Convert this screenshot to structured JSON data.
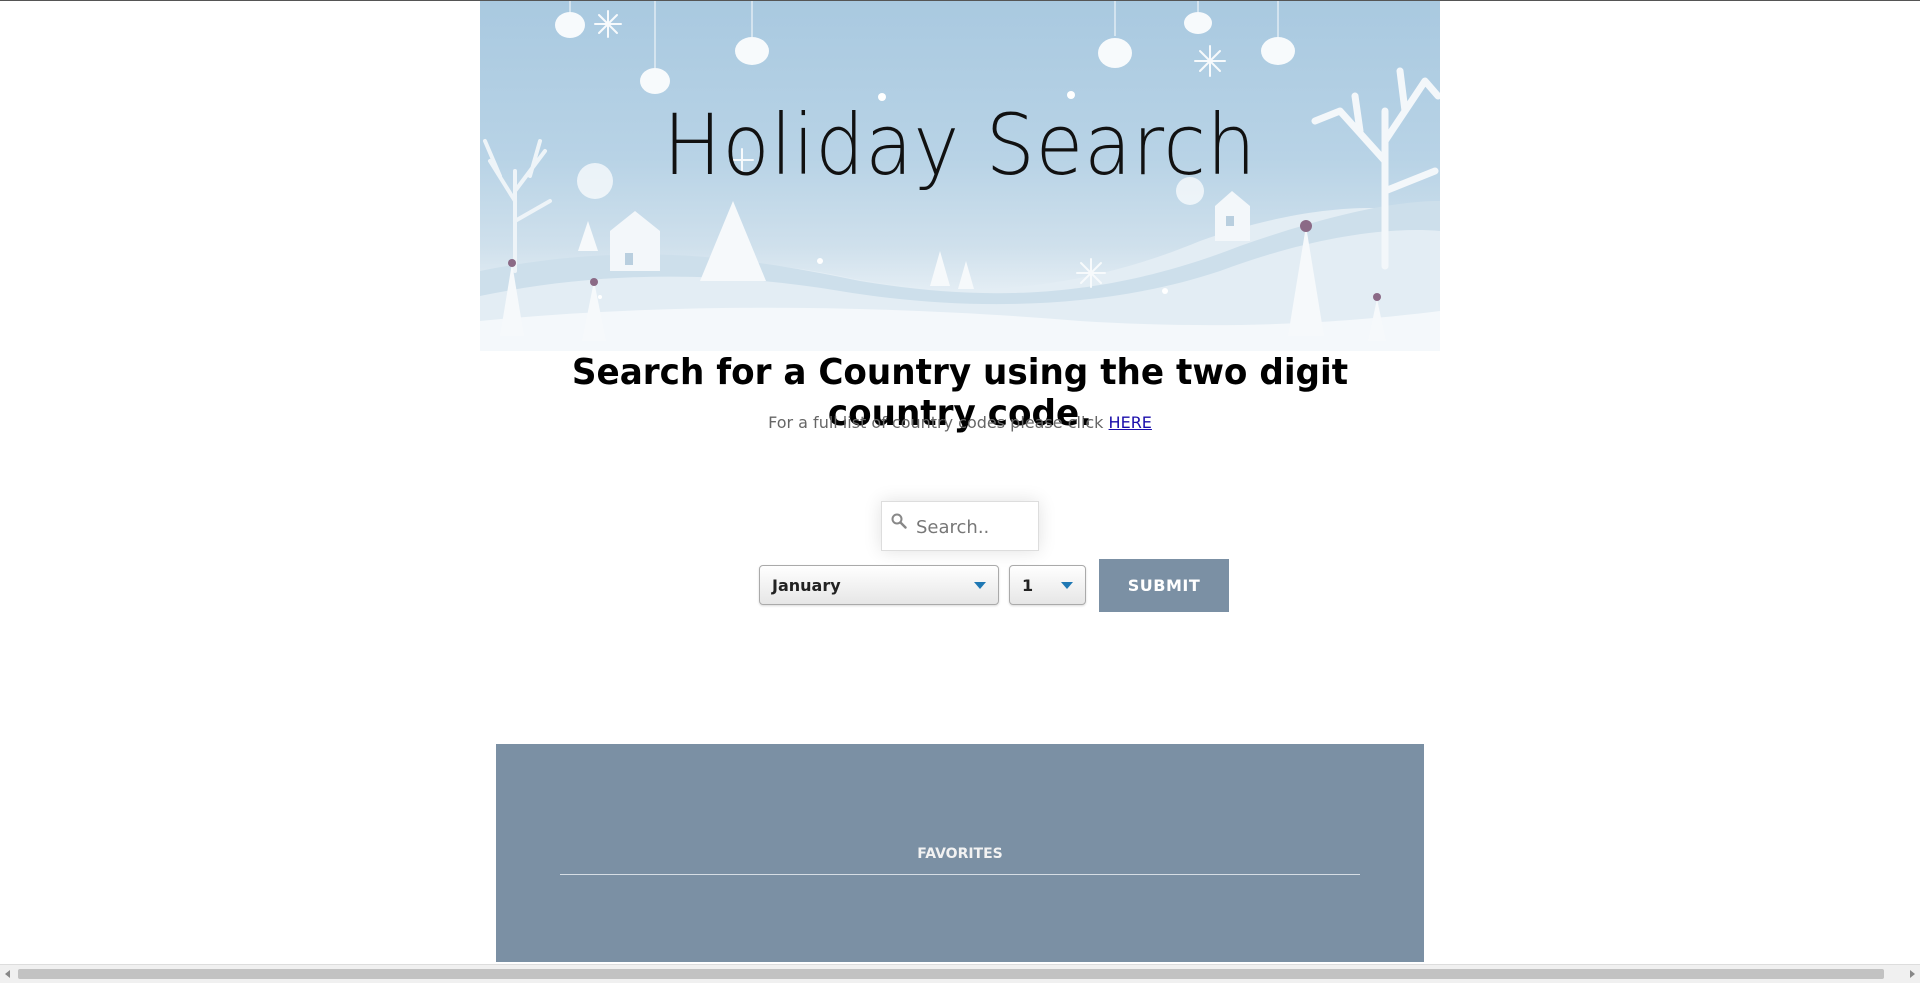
{
  "banner": {
    "title": "Holiday Search"
  },
  "main": {
    "headline": "Search for a Country using the two digit country code.",
    "subtext": "For a full list of country codes please click",
    "link_label": "HERE"
  },
  "search": {
    "placeholder": "Search..",
    "icon": "search-icon"
  },
  "form": {
    "month_selected": "January",
    "day_selected": "1",
    "submit_label": "SUBMIT"
  },
  "favorites": {
    "title": "FAVORITES"
  },
  "colors": {
    "accent": "#7b90a4",
    "link": "#1a0dab",
    "caret": "#1f78b4"
  }
}
